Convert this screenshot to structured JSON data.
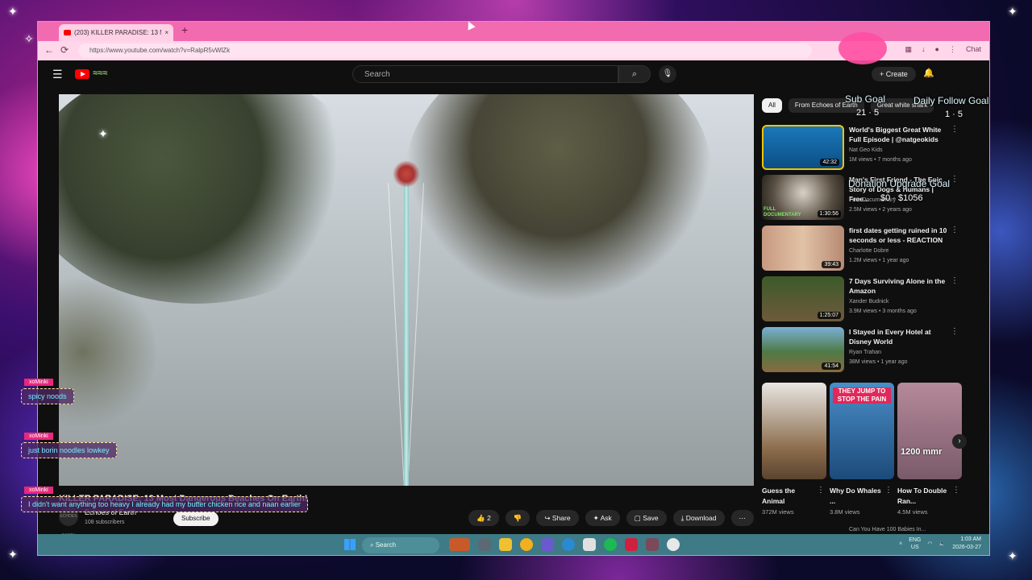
{
  "browser": {
    "tab_title": "(203) KILLER PARADISE: 13 M",
    "tab_close": "×",
    "new_tab": "+",
    "url": "https://www.youtube.com/watch?v=RalpR5vWlZk",
    "back": "←",
    "reload": "⟳",
    "chat_label": "Chat"
  },
  "youtube": {
    "search_placeholder": "Search",
    "create_label": "+ Create",
    "chips": [
      "All",
      "From Echoes of Earth",
      "Great white shark"
    ],
    "recommendations": [
      {
        "title": "World's Biggest Great White Full Episode | @natgeokids",
        "channel": "Nat Geo Kids",
        "meta": "1M views • 7 months ago",
        "duration": "42:32"
      },
      {
        "title": "Man's First Friend - The Epic Story of Dogs & Humans | Free...",
        "channel": "Free Documentary",
        "meta": "2.5M views • 2 years ago",
        "duration": "1:30:56",
        "badge": "FULL DOCUMENTARY"
      },
      {
        "title": "first dates getting ruined in 10 seconds or less - REACTION",
        "channel": "Charlotte Dobre",
        "meta": "1.2M views • 1 year ago",
        "duration": "39:43"
      },
      {
        "title": "7 Days Surviving Alone in the Amazon",
        "channel": "Xander Budnick",
        "meta": "3.9M views • 3 months ago",
        "duration": "1:25:07"
      },
      {
        "title": "I Stayed in Every Hotel at Disney World",
        "channel": "Ryan Trahan",
        "meta": "38M views • 1 year ago",
        "duration": "41:54"
      }
    ],
    "shorts": [
      {
        "title": "Guess the Animal",
        "views": "372M views"
      },
      {
        "title": "Why Do Whales ...",
        "views": "3.8M views",
        "overlay": "THEY JUMP TO STOP THE PAIN"
      },
      {
        "title": "How To Double Ran...",
        "views": "4.5M views",
        "overlay": "1200 mmr"
      }
    ],
    "more_peek": "Can You Have 100 Babies In...",
    "video_title": "KILLER PARADISE: 13 Most Dangerous Beaches On Earth!",
    "channel_name": "Echoes of Earth",
    "channel_avatar_text": "ECHOES EARTH",
    "channel_subs": "108 subscribers",
    "subscribe_label": "Subscribe",
    "actions": {
      "likes": "2",
      "share": "Share",
      "ask": "Ask",
      "save": "Save",
      "download": "Download",
      "more": "⋯"
    }
  },
  "taskbar": {
    "search_label": "Search",
    "lang": "ENG",
    "region": "US",
    "time": "1:03 AM",
    "date": "2026-03-27"
  },
  "overlay": {
    "sub_goal_label": "Sub Goal",
    "sub_goal_value": "21 · 5",
    "follow_goal_label": "Daily Follow Goal",
    "follow_goal_value": "1 · 5",
    "donation_goal_label": "Donation Upgrade Goal",
    "donation_goal_value": "$0 · $1056",
    "chat": [
      {
        "user": "xoMinki",
        "text": "spicy noods"
      },
      {
        "user": "xoMinki",
        "text": "just borin noodles lowkey"
      },
      {
        "user": "xoMinki",
        "text": "I didn't want anything too heavy I already had my butter chicken rice and naan earlier"
      }
    ]
  }
}
